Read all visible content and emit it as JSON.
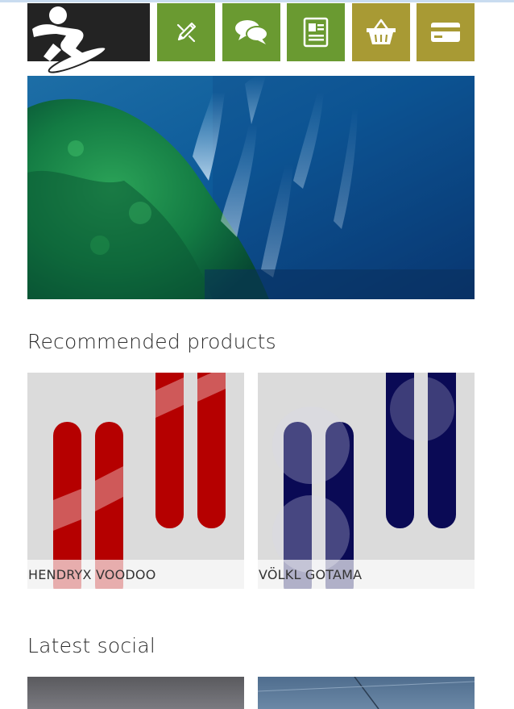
{
  "nav": {
    "logo_icon": "snowboarder-icon",
    "items": [
      {
        "icon": "pencil-icon",
        "color": "#6a9a31"
      },
      {
        "icon": "chat-icon",
        "color": "#6a9a31"
      },
      {
        "icon": "contact-card-icon",
        "color": "#6a9a31"
      },
      {
        "icon": "basket-icon",
        "color": "#a89a34"
      },
      {
        "icon": "credit-card-icon",
        "color": "#a89a34"
      }
    ]
  },
  "recommended": {
    "title": "Recommended products",
    "products": [
      {
        "name": "HENDRYX VOODOO",
        "ski_color": "#b50000"
      },
      {
        "name": "VÖLKL GOTAMA",
        "ski_color": "#0a0a55"
      }
    ]
  },
  "social": {
    "title": "Latest social"
  }
}
